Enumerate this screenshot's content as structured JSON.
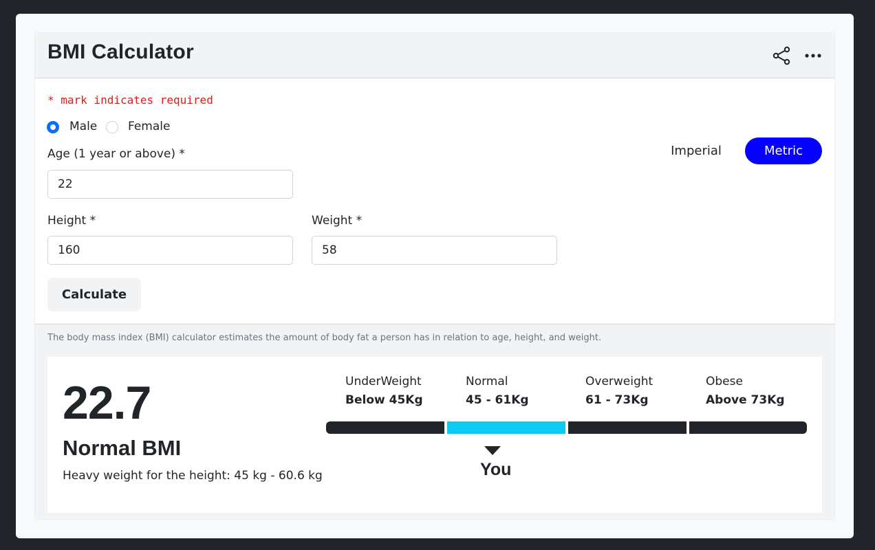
{
  "header": {
    "title": "BMI Calculator",
    "icons": [
      "share-icon",
      "more-icon"
    ]
  },
  "form": {
    "required_note": "* mark indicates required",
    "gender": {
      "options": [
        "Male",
        "Female"
      ],
      "selected": "Male"
    },
    "units": {
      "imperial_label": "Imperial",
      "metric_label": "Metric",
      "selected": "Metric"
    },
    "age": {
      "label": "Age (1 year or above) *",
      "value": "22"
    },
    "height": {
      "label": "Height *",
      "value": "160"
    },
    "weight": {
      "label": "Weight *",
      "value": "58"
    },
    "calculate_label": "Calculate"
  },
  "info_text": "The body mass index (BMI) calculator estimates the amount of body fat a person has in relation to age, height, and weight.",
  "result": {
    "bmi": "22.7",
    "category": "Normal BMI",
    "note": "Heavy weight for the height: 45 kg - 60.6 kg",
    "scale": [
      {
        "name": "UnderWeight",
        "range": "Below 45Kg"
      },
      {
        "name": "Normal",
        "range": "45 - 61Kg"
      },
      {
        "name": "Overweight",
        "range": "61 - 73Kg"
      },
      {
        "name": "Obese",
        "range": "Above 73Kg"
      }
    ],
    "active_segment": "Normal",
    "marker_label": "You"
  },
  "colors": {
    "accent": "#0600ff",
    "radio_selected": "#0d6efd",
    "required": "#dc1b1b",
    "active_segment": "#0dcaf0",
    "segment": "#212529"
  }
}
